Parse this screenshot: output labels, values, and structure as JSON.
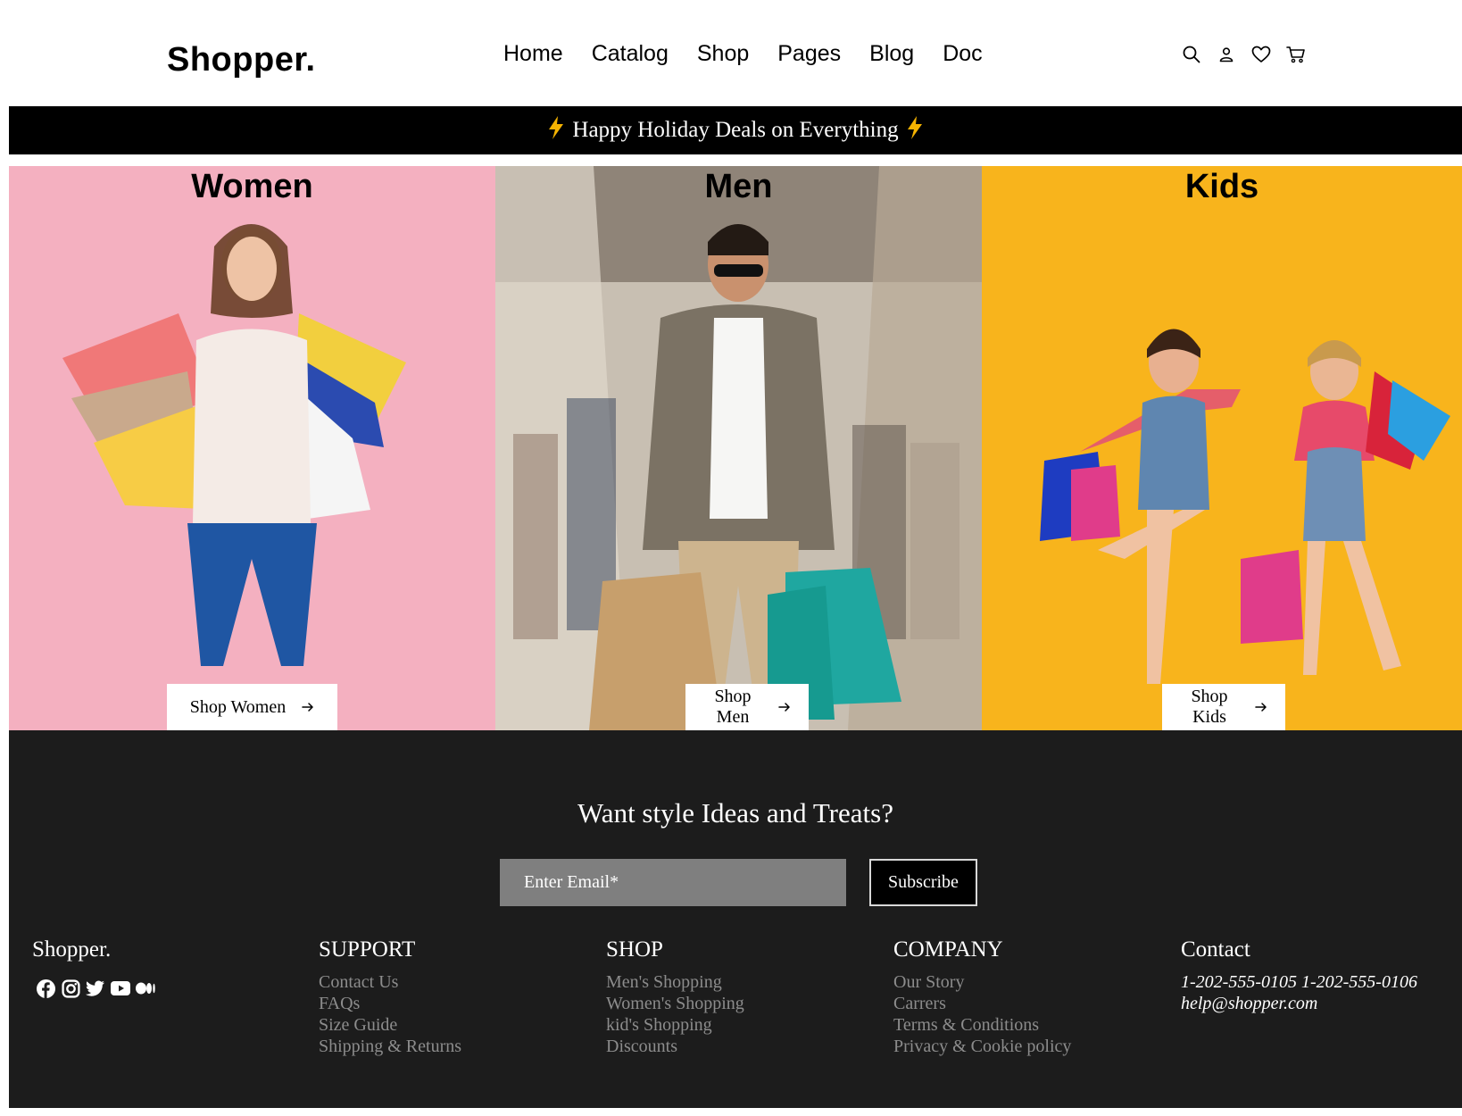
{
  "header": {
    "logo": "Shopper.",
    "nav": [
      "Home",
      "Catalog",
      "Shop",
      "Pages",
      "Blog",
      "Doc"
    ],
    "icons": [
      "search-icon",
      "user-icon",
      "heart-icon",
      "cart-icon"
    ]
  },
  "promo": {
    "text": "Happy Holiday Deals on Everything",
    "icon": "lightning-icon",
    "icon_color": "#f5b301"
  },
  "hero": {
    "panels": [
      {
        "title": "Women",
        "button": "Shop Women",
        "bg": "#f5b4c3"
      },
      {
        "title": "Men",
        "button": "Shop Men",
        "bg": "#b9ad9e"
      },
      {
        "title": "Kids",
        "button": "Shop Kids",
        "bg": "#f8b51c"
      }
    ],
    "button_icon": "arrow-right-icon"
  },
  "footer": {
    "newsletter_title": "Want style Ideas and Treats?",
    "email_placeholder": "Enter Email*",
    "subscribe_label": "Subscribe",
    "brand": "Shopper.",
    "social_icons": [
      "facebook-icon",
      "instagram-icon",
      "twitter-icon",
      "youtube-icon",
      "medium-icon"
    ],
    "columns": [
      {
        "heading": "SUPPORT",
        "links": [
          "Contact Us",
          "FAQs",
          "Size Guide",
          "Shipping & Returns"
        ]
      },
      {
        "heading": "SHOP",
        "links": [
          "Men's Shopping",
          "Women's Shopping",
          "kid's Shopping",
          "Discounts"
        ]
      },
      {
        "heading": "COMPANY",
        "links": [
          "Our Story",
          "Carrers",
          "Terms & Conditions",
          "Privacy & Cookie policy"
        ]
      }
    ],
    "contact": {
      "heading": "Contact",
      "phones": "1-202-555-0105 1-202-555-0106",
      "email": "help@shopper.com"
    },
    "bg": "#1c1c1c"
  }
}
